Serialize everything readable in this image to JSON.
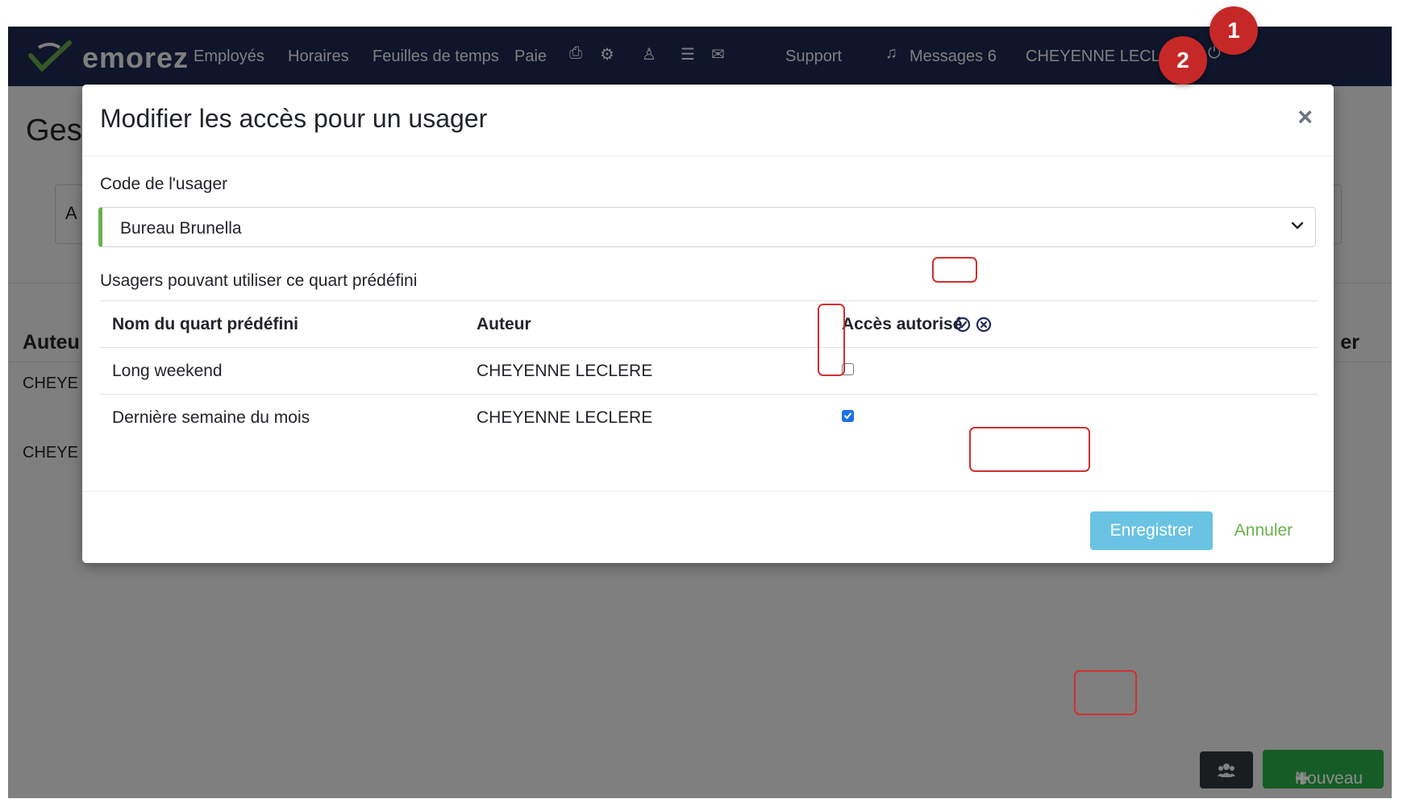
{
  "navbar": {
    "logo": "emorez",
    "items": [
      "Employés",
      "Horaires",
      "Feuilles de temps",
      "Paie",
      "Support",
      "Messages 6",
      "CHEYENNE LECLERE"
    ]
  },
  "background": {
    "page_title": "Ges",
    "filter_text": "A",
    "table_header_left": "Auteu",
    "table_header_right": "er",
    "rows": [
      "CHEYE",
      "CHEYE"
    ],
    "new_button_label": "Nouveau"
  },
  "modal": {
    "title": "Modifier les accès pour un usager",
    "close_symbol": "×",
    "user_code_label": "Code de l'usager",
    "user_code_value": "Bureau Brunella",
    "section_label": "Usagers pouvant utiliser ce quart prédéfini",
    "table": {
      "headers": [
        "Nom du quart prédéfini",
        "Auteur",
        "Accès autorisé"
      ],
      "rows": [
        {
          "name": "Long weekend",
          "author": "CHEYENNE LECLERE",
          "allowed": false
        },
        {
          "name": "Dernière semaine du mois",
          "author": "CHEYENNE LECLERE",
          "allowed": true
        }
      ]
    },
    "save_label": "Enregistrer",
    "cancel_label": "Annuler"
  },
  "annotations": {
    "badge_1": "1",
    "badge_2": "2"
  },
  "colors": {
    "navbar": "#1e2a55",
    "accent_green": "#6ab04c",
    "save_button": "#6ac3e3",
    "new_button": "#28a745",
    "annotation_red": "#c62828"
  }
}
